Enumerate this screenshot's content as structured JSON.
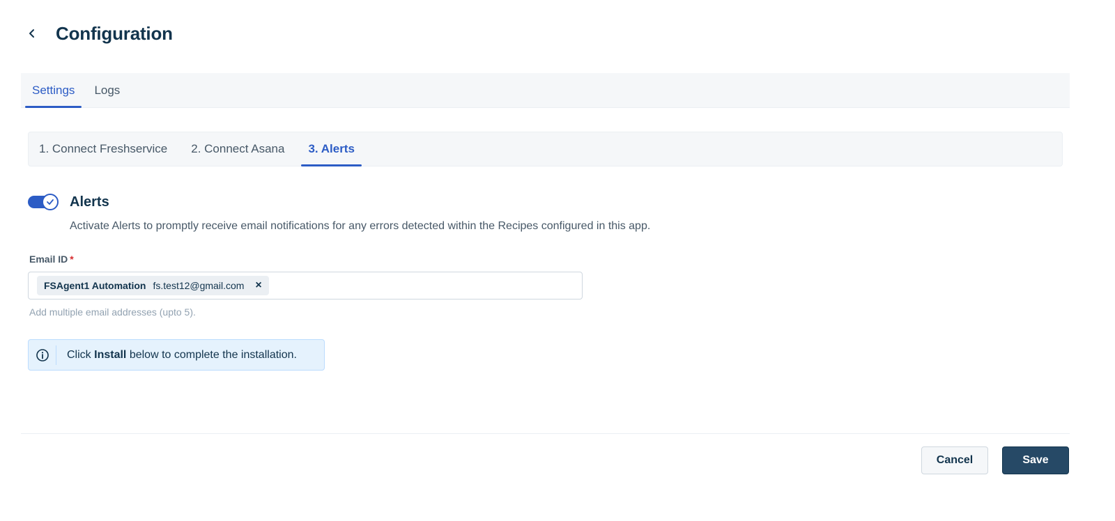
{
  "header": {
    "title": "Configuration",
    "back_icon": "chevron-left-icon"
  },
  "main_tabs": [
    {
      "label": "Settings",
      "active": true
    },
    {
      "label": "Logs",
      "active": false
    }
  ],
  "step_tabs": [
    {
      "label": "1. Connect Freshservice",
      "active": false
    },
    {
      "label": "2. Connect Asana",
      "active": false
    },
    {
      "label": "3. Alerts",
      "active": true
    }
  ],
  "alerts": {
    "toggle_on": true,
    "title": "Alerts",
    "description": "Activate Alerts to promptly receive email notifications for any errors detected within the Recipes configured in this app."
  },
  "email": {
    "label": "Email ID",
    "required_mark": "*",
    "chips": [
      {
        "name": "FSAgent1 Automation",
        "email": "fs.test12@gmail.com",
        "remove": "×"
      }
    ],
    "helper": "Add multiple email addresses (upto 5)."
  },
  "info": {
    "prefix": "Click",
    "bold": "Install",
    "suffix": "below to complete the installation."
  },
  "footer": {
    "cancel_label": "Cancel",
    "save_label": "Save"
  },
  "colors": {
    "accent": "#2c5cc5",
    "primary_button": "#264966",
    "info_bg": "#e5f2fd",
    "text": "#12344d"
  }
}
